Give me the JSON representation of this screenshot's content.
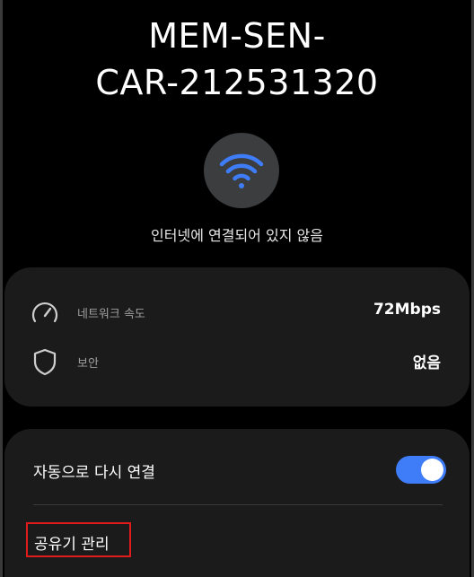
{
  "network": {
    "name": "MEM-SEN-\nCAR-212531320",
    "status": "인터넷에 연결되어 있지 않음",
    "wifi_icon": "wifi-icon"
  },
  "details": {
    "speed_label": "네트워크 속도",
    "speed_value": "72Mbps",
    "speed_icon": "speedometer-icon",
    "security_label": "보안",
    "security_value": "없음",
    "security_icon": "shield-icon"
  },
  "settings": {
    "auto_reconnect_label": "자동으로 다시 연결",
    "auto_reconnect_on": true,
    "manage_router_label": "공유기 관리"
  },
  "colors": {
    "background": "#000000",
    "card": "#1b1b1b",
    "toggle_on": "#3e7df7",
    "wifi_icon": "#3e7df7",
    "highlight_box": "#e01b1b"
  }
}
